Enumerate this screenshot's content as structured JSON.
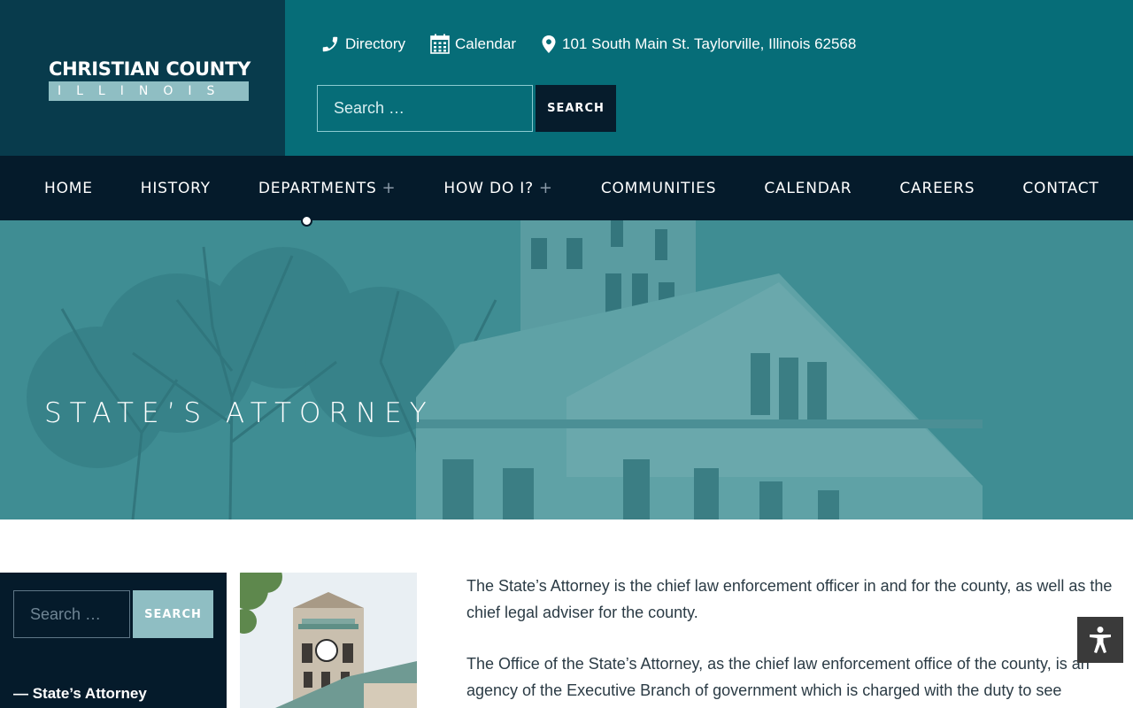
{
  "header": {
    "logo_line1": "CHRISTIAN COUNTY",
    "logo_line2": "ILLINOIS",
    "contact": {
      "directory": "Directory",
      "calendar": "Calendar",
      "address": "101 South Main St. Taylorville, Illinois 62568"
    },
    "search_placeholder": "Search …",
    "search_button": "SEARCH"
  },
  "nav": {
    "items": [
      {
        "label": "HOME"
      },
      {
        "label": "HISTORY"
      },
      {
        "label": "DEPARTMENTS",
        "plus": "+"
      },
      {
        "label": "HOW DO I?",
        "plus": "+"
      },
      {
        "label": "COMMUNITIES"
      },
      {
        "label": "CALENDAR"
      },
      {
        "label": "CAREERS"
      },
      {
        "label": "CONTACT"
      }
    ]
  },
  "hero": {
    "title": "STATE’S ATTORNEY"
  },
  "sidebar": {
    "search_placeholder": "Search …",
    "search_button": "SEARCH",
    "link": "— State’s Attorney"
  },
  "article": {
    "paragraphs": [
      "The State’s Attorney is the chief law enforcement officer in and for the county, as well as the chief legal adviser for the county.",
      "The Office of the State’s Attorney, as the chief law enforcement office of the county, is an agency of the Executive Branch of government which is charged with the duty to see"
    ]
  },
  "colors": {
    "header_teal": "#066d78",
    "logo_bg": "#083b4c",
    "nav_bg": "#051b2b",
    "hero_overlay": "#3f8d93",
    "accent_light": "#8fbec3"
  }
}
